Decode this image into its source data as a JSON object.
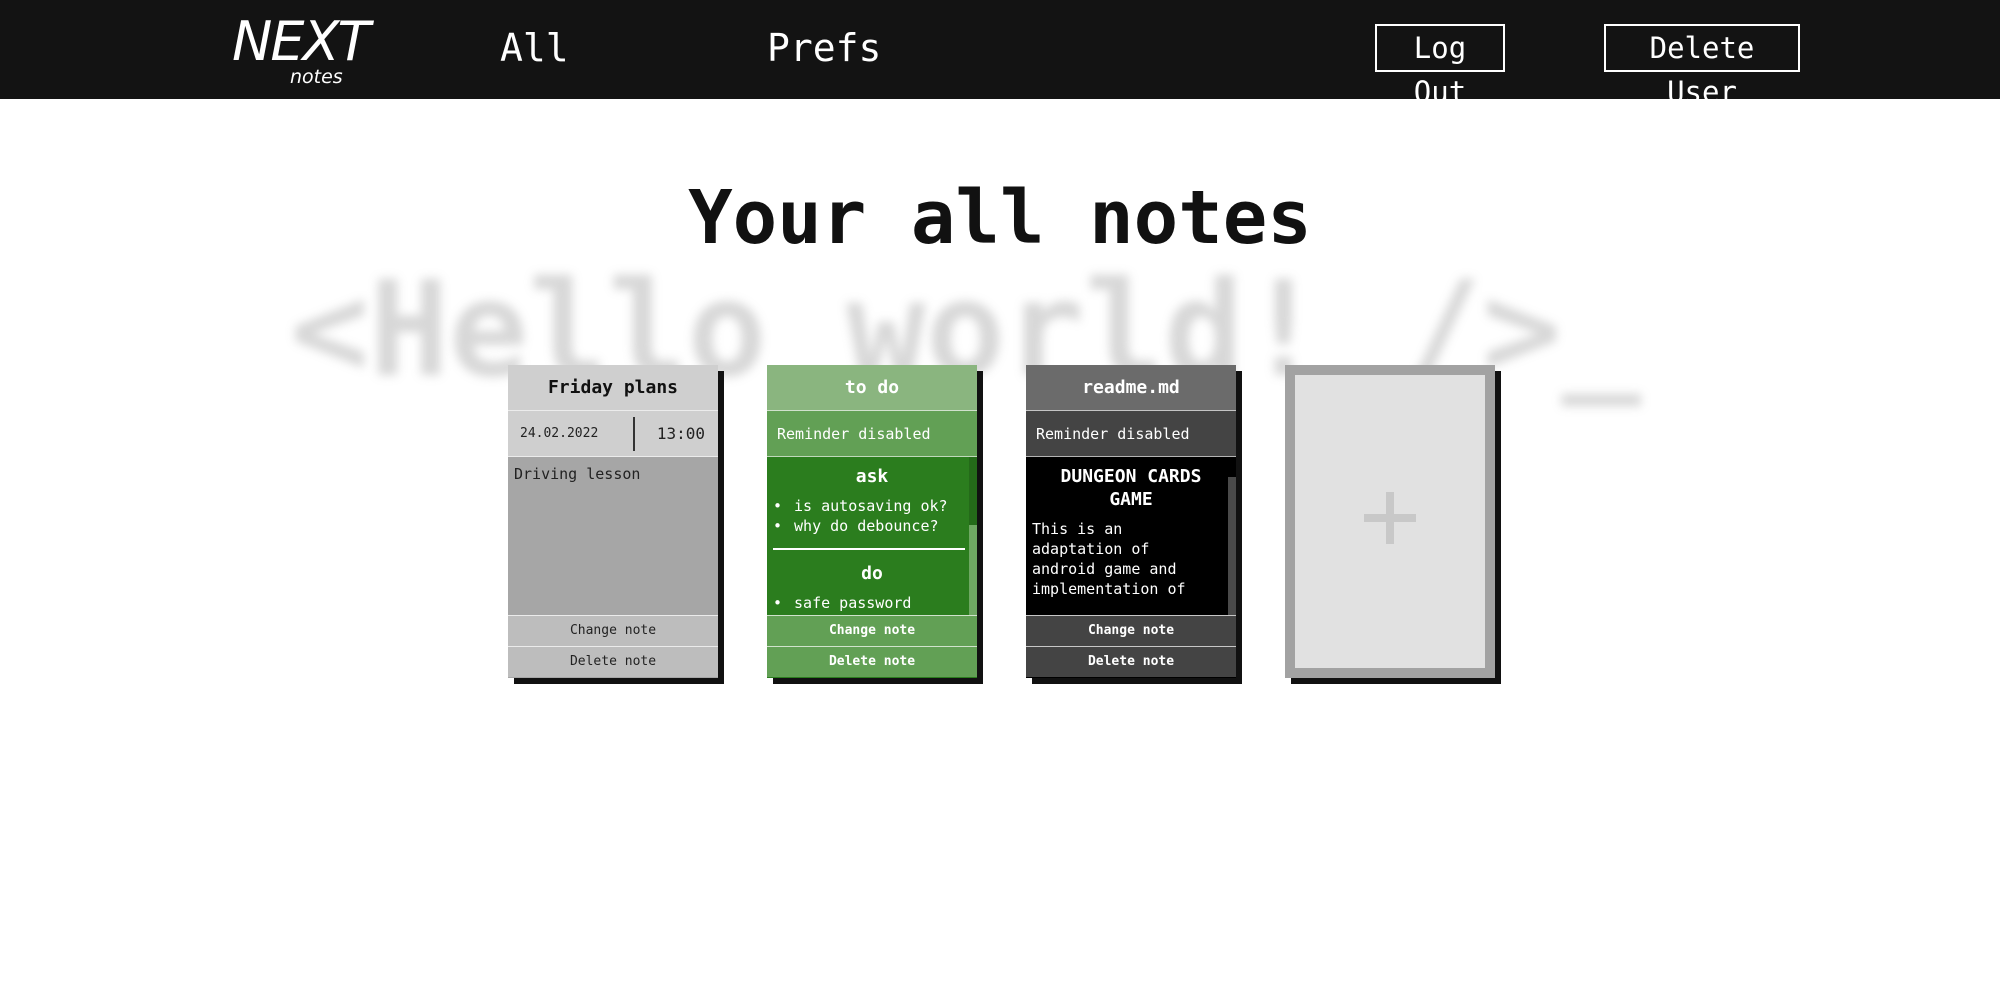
{
  "nav": {
    "logo_main": "NEXT",
    "logo_sub": "notes",
    "links": [
      "All",
      "Prefs"
    ],
    "logout_label": "Log Out",
    "delete_user_label": "Delete User"
  },
  "main": {
    "title": "Your all notes",
    "background_text": "<Hello world! />_"
  },
  "notes": [
    {
      "title": "Friday plans",
      "reminder_date": "24.02.2022",
      "reminder_time": "13:00",
      "body": "Driving lesson",
      "change_label": "Change note",
      "delete_label": "Delete note",
      "color": "#a6a6a6"
    },
    {
      "title": "to do",
      "reminder": "Reminder disabled",
      "sections": [
        {
          "heading": "ask",
          "items": [
            "is autosaving ok?",
            "why do debounce?"
          ]
        },
        {
          "heading": "do",
          "items": [
            "safe password"
          ]
        }
      ],
      "change_label": "Change note",
      "delete_label": "Delete note",
      "color": "#2b7d1e"
    },
    {
      "title": "readme.md",
      "reminder": "Reminder disabled",
      "heading": "DUNGEON CARDS GAME",
      "body": "This is an adaptation of android game and implementation of",
      "change_label": "Change note",
      "delete_label": "Delete note",
      "color": "#000000"
    }
  ],
  "add_note": {
    "icon": "plus-icon"
  }
}
